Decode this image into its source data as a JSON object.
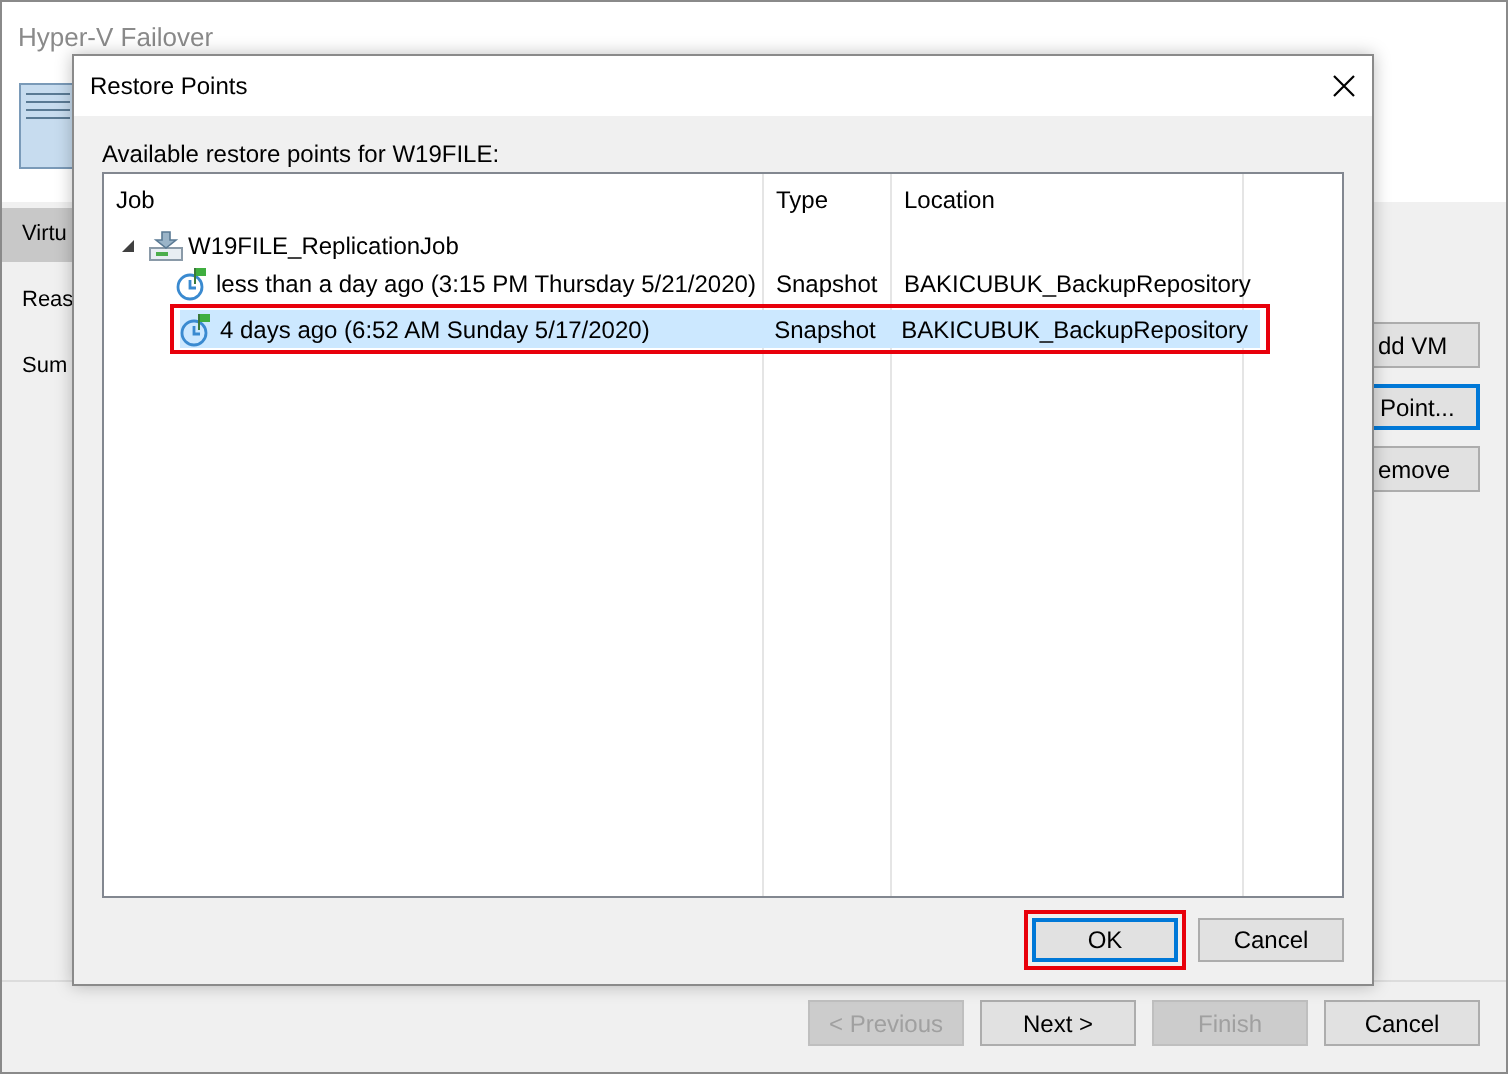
{
  "window": {
    "title": "Hyper-V Failover"
  },
  "sidebar": {
    "items": [
      {
        "label": "Virtu",
        "selected": true
      },
      {
        "label": "Reas",
        "selected": false
      },
      {
        "label": "Sum",
        "selected": false
      }
    ]
  },
  "side_buttons": [
    {
      "label": "dd VM",
      "focused": false
    },
    {
      "label": "Point...",
      "focused": true
    },
    {
      "label": "emove",
      "focused": false
    }
  ],
  "footer_buttons": [
    {
      "label": "< Previous",
      "disabled": true
    },
    {
      "label": "Next >",
      "disabled": false
    },
    {
      "label": "Finish",
      "disabled": true
    },
    {
      "label": "Cancel",
      "disabled": false
    }
  ],
  "dialog": {
    "title": "Restore Points",
    "caption": "Available restore points for W19FILE:",
    "columns": [
      "Job",
      "Type",
      "Location"
    ],
    "tree": [
      {
        "label": "W19FILE_ReplicationJob",
        "expanded": true,
        "children": [
          {
            "label": "less than a day ago (3:15 PM Thursday 5/21/2020)",
            "type": "Snapshot",
            "location": "BAKICUBUK_BackupRepository",
            "selected": false,
            "highlighted": false
          },
          {
            "label": "4 days ago (6:52 AM Sunday 5/17/2020)",
            "type": "Snapshot",
            "location": "BAKICUBUK_BackupRepository",
            "selected": true,
            "highlighted": true
          }
        ]
      }
    ],
    "buttons": [
      {
        "label": "OK",
        "default": true,
        "highlighted": true
      },
      {
        "label": "Cancel",
        "default": false,
        "highlighted": false
      }
    ]
  }
}
